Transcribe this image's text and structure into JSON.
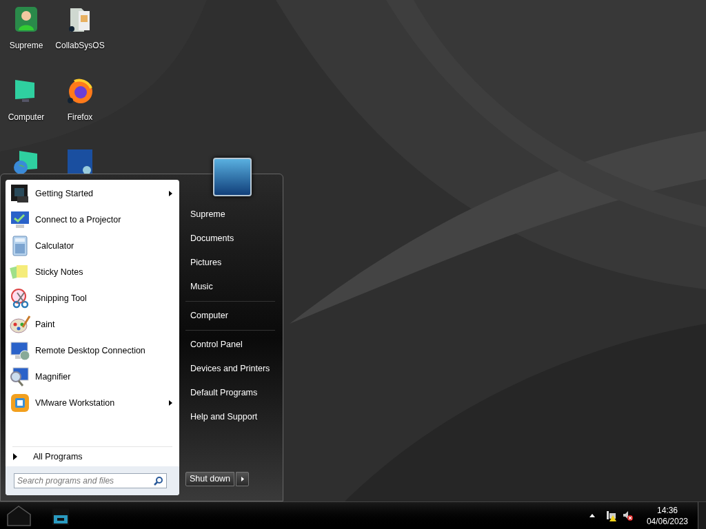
{
  "desktop_icons": [
    {
      "label": "Supreme"
    },
    {
      "label": "CollabSysOS"
    },
    {
      "label": "Computer"
    },
    {
      "label": "Firefox"
    }
  ],
  "start_menu": {
    "programs": [
      {
        "label": "Getting Started",
        "submenu": true
      },
      {
        "label": "Connect to a Projector",
        "submenu": false
      },
      {
        "label": "Calculator",
        "submenu": false
      },
      {
        "label": "Sticky Notes",
        "submenu": false
      },
      {
        "label": "Snipping Tool",
        "submenu": false
      },
      {
        "label": "Paint",
        "submenu": false
      },
      {
        "label": "Remote Desktop Connection",
        "submenu": false
      },
      {
        "label": "Magnifier",
        "submenu": false
      },
      {
        "label": "VMware Workstation",
        "submenu": true
      }
    ],
    "all_programs": "All Programs",
    "search": {
      "placeholder": "Search programs and files"
    },
    "link_groups": [
      [
        "Supreme",
        "Documents",
        "Pictures",
        "Music"
      ],
      [
        "Computer"
      ],
      [
        "Control Panel",
        "Devices and Printers",
        "Default Programs",
        "Help and Support"
      ]
    ],
    "shutdown": "Shut down"
  },
  "taskbar": {
    "time": "14:36",
    "date": "04/06/2023"
  }
}
